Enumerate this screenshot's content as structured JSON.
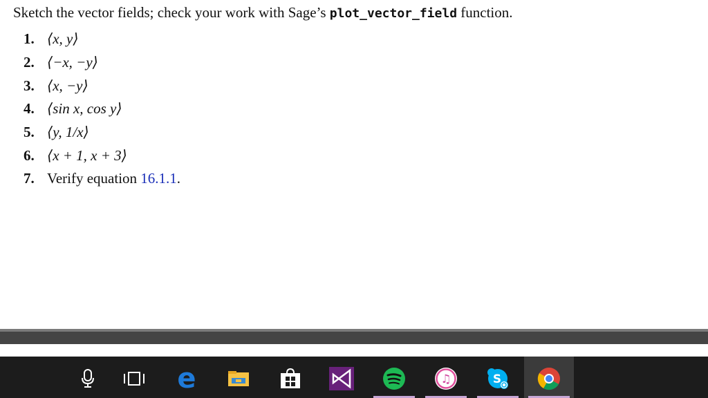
{
  "document": {
    "intro_pre": "Sketch the vector fields; check your work with Sage’s",
    "intro_code": "plot_vector_field",
    "intro_post": "function.",
    "items": [
      {
        "num": "1.",
        "text": "⟨x, y⟩"
      },
      {
        "num": "2.",
        "text": "⟨−x, −y⟩"
      },
      {
        "num": "3.",
        "text": "⟨x, −y⟩"
      },
      {
        "num": "4.",
        "text": "⟨sin x, cos y⟩"
      },
      {
        "num": "5.",
        "text": "⟨y, 1/x⟩"
      },
      {
        "num": "6.",
        "text": "⟨x + 1, x + 3⟩"
      },
      {
        "num": "7.",
        "text_pre": "Verify equation",
        "ref": "16.1.1",
        "text_post": "."
      }
    ]
  },
  "taskbar": {
    "icons": [
      "microphone-icon",
      "task-view-icon",
      "edge-icon",
      "file-explorer-icon",
      "store-icon",
      "visual-studio-icon",
      "spotify-icon",
      "itunes-icon",
      "skype-icon",
      "chrome-icon"
    ],
    "colors": {
      "background": "#1c1c1c",
      "running_indicator": "#c7a6d6",
      "active_highlight": "#3b3b3b"
    }
  }
}
